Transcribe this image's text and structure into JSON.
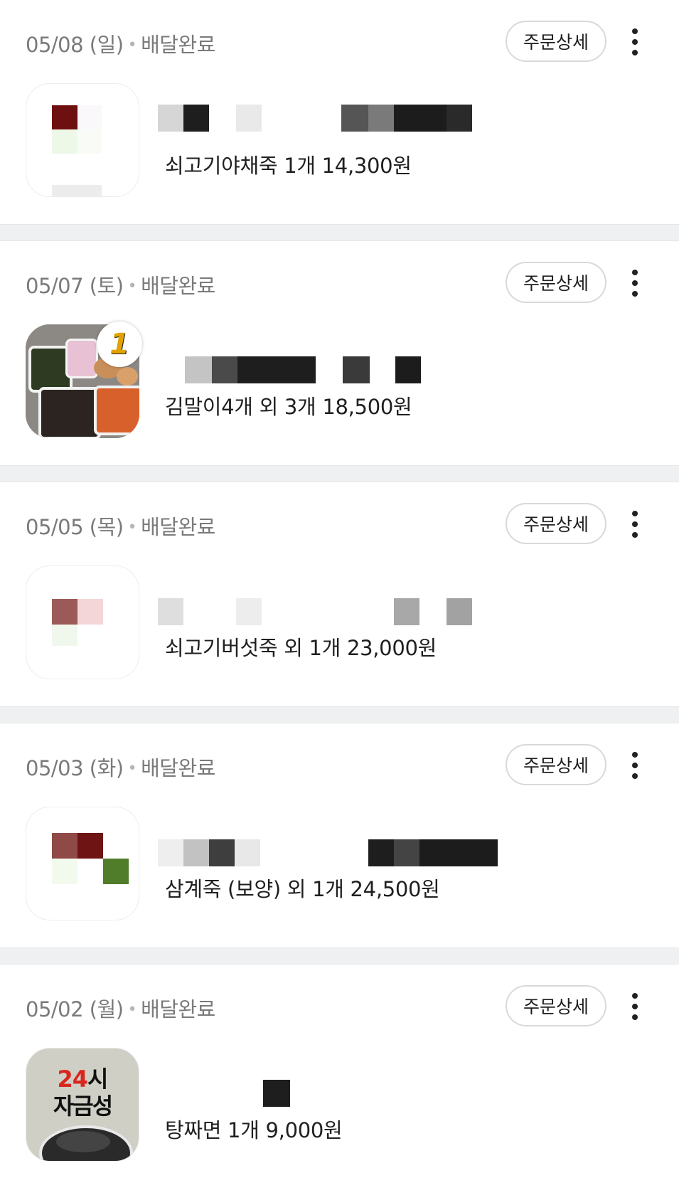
{
  "orders": [
    {
      "date": "05/08 (일)",
      "status": "배달완료",
      "detail_label": "주문상세",
      "summary": "쇠고기야채죽 1개 14,300원"
    },
    {
      "date": "05/07 (토)",
      "status": "배달완료",
      "detail_label": "주문상세",
      "summary": "김말이4개 외 3개 18,500원"
    },
    {
      "date": "05/05 (목)",
      "status": "배달완료",
      "detail_label": "주문상세",
      "summary": "쇠고기버섯죽 외 1개 23,000원"
    },
    {
      "date": "05/03 (화)",
      "status": "배달완료",
      "detail_label": "주문상세",
      "summary": "삼계죽 (보양) 외 1개 24,500원"
    },
    {
      "date": "05/02 (월)",
      "status": "배달완료",
      "detail_label": "주문상세",
      "summary": "탕짜면 1개 9,000원"
    }
  ],
  "order5_logo": {
    "line1_red": "24",
    "line1_black": "시",
    "line2": "자금성"
  },
  "order2_badge": "1",
  "separator": "•",
  "icons": {
    "more": "more-vertical-icon"
  }
}
